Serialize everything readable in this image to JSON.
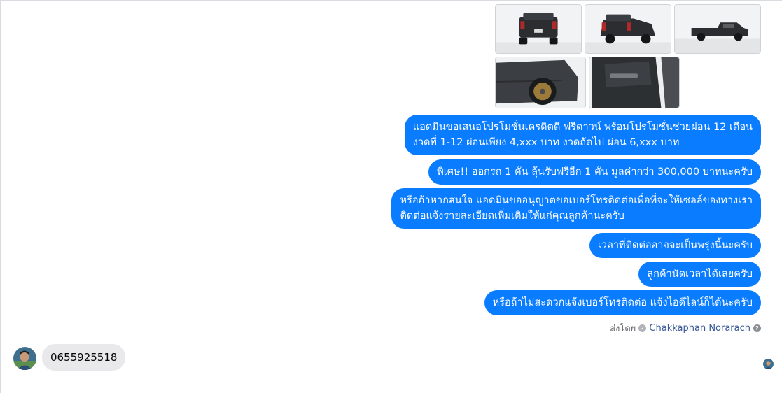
{
  "photos": [
    {
      "name": "truck-rear-photo",
      "kind": "rear"
    },
    {
      "name": "truck-rear-quarter-photo",
      "kind": "rear2"
    },
    {
      "name": "truck-side-photo",
      "kind": "side"
    },
    {
      "name": "truck-wheel-photo",
      "kind": "wheel"
    },
    {
      "name": "truck-door-interior-photo",
      "kind": "door"
    }
  ],
  "messages": [
    {
      "lines": [
        "แอดมินขอเสนอโปรโมชั่นเครดิตดี ฟรีดาวน์ พร้อมโปรโมชั่นช่วยผ่อน 12 เดือน",
        "งวดที่ 1-12 ผ่อนเพียง 4,xxx บาท งวดถัดไป ผ่อน 6,xxx บาท"
      ]
    },
    {
      "lines": [
        "พิเศษ!! ออกรถ 1 คัน ลุ้นรับฟรีอีก 1 คัน มูลค่ากว่า 300,000 บาทนะครับ"
      ]
    },
    {
      "lines": [
        "หรือถ้าหากสนใจ แอดมินขออนุญาตขอเบอร์โทรติดต่อเพื่อที่จะให้เซลล์ของทางเรา",
        "ติดต่อแจ้งรายละเอียดเพิ่มเติมให้แก่คุณลูกค้านะครับ"
      ]
    },
    {
      "lines": [
        "เวลาที่ติดต่ออาจจะเป็นพรุ่งนี้นะครับ"
      ]
    },
    {
      "lines": [
        "ลูกค้านัดเวลาได้เลยครับ"
      ]
    },
    {
      "lines": [
        "หรือถ้าไม่สะดวกแจ้งเบอร์โทรติดต่อ แจ้งไอดีไลน์ก็ได้นะครับ"
      ]
    }
  ],
  "sent_by": {
    "label": "ส่งโดย",
    "name": "Chakkaphan Norarach",
    "help_icon": "?"
  },
  "incoming": {
    "text": "0655925518"
  },
  "colors": {
    "bubble": "#0a7cff",
    "incoming_bubble": "#e9e9eb",
    "link": "#385898"
  }
}
